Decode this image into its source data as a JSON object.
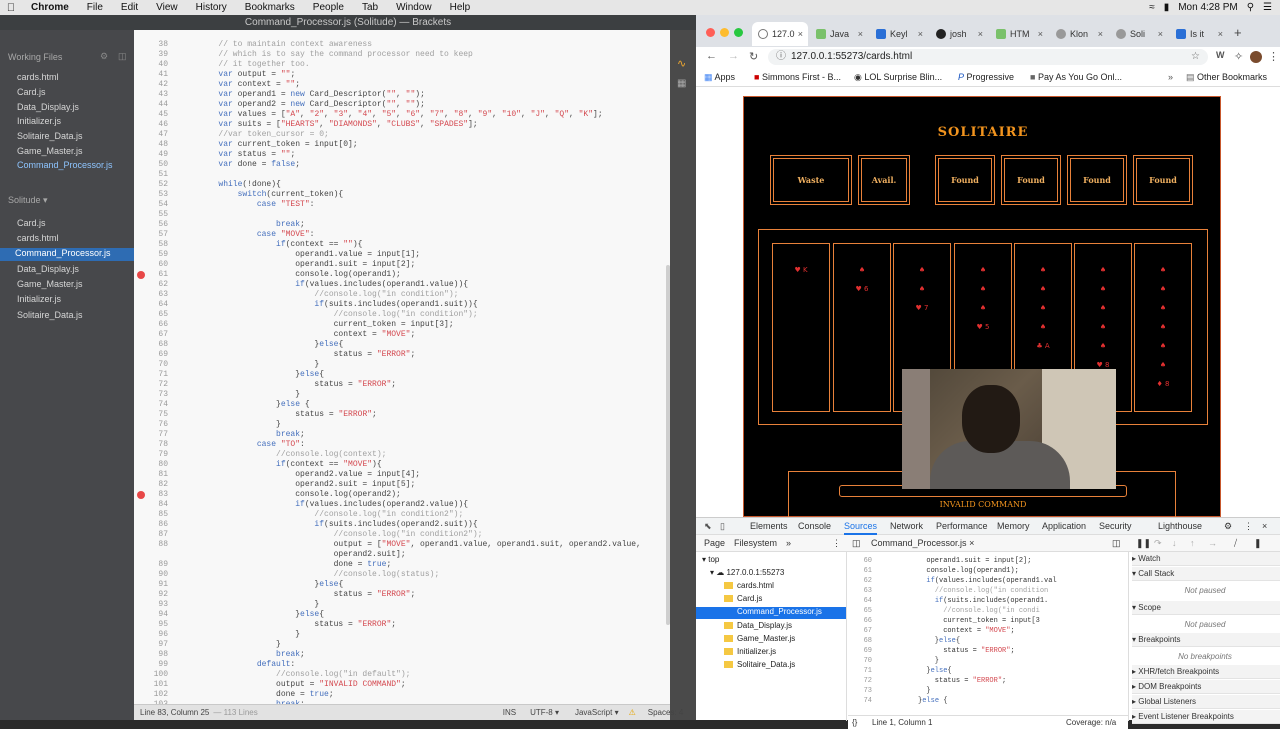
{
  "menubar": {
    "app": "Chrome",
    "items": [
      "File",
      "Edit",
      "View",
      "History",
      "Bookmarks",
      "People",
      "Tab",
      "Window",
      "Help"
    ],
    "clock": "Mon 4:28 PM"
  },
  "brackets": {
    "title": "Command_Processor.js (Solitude) — Brackets",
    "working_files_label": "Working Files",
    "working_files": [
      "cards.html",
      "Card.js",
      "Data_Display.js",
      "Initializer.js",
      "Solitaire_Data.js",
      "Game_Master.js",
      "Command_Processor.js"
    ],
    "project_label": "Solitude",
    "project_files": [
      "Card.js",
      "cards.html",
      "Command_Processor.js",
      "Data_Display.js",
      "Game_Master.js",
      "Initializer.js",
      "Solitaire_Data.js"
    ],
    "code_lines": [
      {
        "n": "38",
        "t": "        // to maintain context awareness"
      },
      {
        "n": "39",
        "t": "        // which is to say the command processor need to keep"
      },
      {
        "n": "40",
        "t": "        // it together too."
      },
      {
        "n": "41",
        "t": "        var output = \"\";"
      },
      {
        "n": "42",
        "t": "        var context = \"\";"
      },
      {
        "n": "43",
        "t": "        var operand1 = new Card_Descriptor(\"\", \"\");"
      },
      {
        "n": "44",
        "t": "        var operand2 = new Card_Descriptor(\"\", \"\");"
      },
      {
        "n": "45",
        "t": "        var values = [\"A\", \"2\", \"3\", \"4\", \"5\", \"6\", \"7\", \"8\", \"9\", \"10\", \"J\", \"Q\", \"K\"];"
      },
      {
        "n": "46",
        "t": "        var suits = [\"HEARTS\", \"DIAMONDS\", \"CLUBS\", \"SPADES\"];"
      },
      {
        "n": "47",
        "t": "        //var token_cursor = 0;"
      },
      {
        "n": "48",
        "t": "        var current_token = input[0];"
      },
      {
        "n": "49",
        "t": "        var status = \"\";"
      },
      {
        "n": "50",
        "t": "        var done = false;"
      },
      {
        "n": "51",
        "t": ""
      },
      {
        "n": "52",
        "t": "        while(!done){"
      },
      {
        "n": "53",
        "t": "            switch(current_token){"
      },
      {
        "n": "54",
        "t": "                case \"TEST\":"
      },
      {
        "n": "55",
        "t": ""
      },
      {
        "n": "56",
        "t": "                    break;"
      },
      {
        "n": "57",
        "t": "                case \"MOVE\":"
      },
      {
        "n": "58",
        "t": "                    if(context == \"\"){"
      },
      {
        "n": "59",
        "t": "                        operand1.value = input[1];"
      },
      {
        "n": "60",
        "t": "                        operand1.suit = input[2];"
      },
      {
        "n": "61",
        "t": "                        console.log(operand1);"
      },
      {
        "n": "62",
        "t": "                        if(values.includes(operand1.value)){"
      },
      {
        "n": "63",
        "t": "                            //console.log(\"in condition\");"
      },
      {
        "n": "64",
        "t": "                            if(suits.includes(operand1.suit)){"
      },
      {
        "n": "65",
        "t": "                                //console.log(\"in condition\");"
      },
      {
        "n": "66",
        "t": "                                current_token = input[3];"
      },
      {
        "n": "67",
        "t": "                                context = \"MOVE\";"
      },
      {
        "n": "68",
        "t": "                            }else{"
      },
      {
        "n": "69",
        "t": "                                status = \"ERROR\";"
      },
      {
        "n": "70",
        "t": "                            }"
      },
      {
        "n": "71",
        "t": "                        }else{"
      },
      {
        "n": "72",
        "t": "                            status = \"ERROR\";"
      },
      {
        "n": "73",
        "t": "                        }"
      },
      {
        "n": "74",
        "t": "                    }else {"
      },
      {
        "n": "75",
        "t": "                        status = \"ERROR\";"
      },
      {
        "n": "76",
        "t": "                    }"
      },
      {
        "n": "77",
        "t": "                    break;"
      },
      {
        "n": "78",
        "t": "                case \"TO\":"
      },
      {
        "n": "79",
        "t": "                    //console.log(context);"
      },
      {
        "n": "80",
        "t": "                    if(context == \"MOVE\"){"
      },
      {
        "n": "81",
        "t": "                        operand2.value = input[4];"
      },
      {
        "n": "82",
        "t": "                        operand2.suit = input[5];"
      },
      {
        "n": "83",
        "t": "                        console.log(operand2);"
      },
      {
        "n": "84",
        "t": "                        if(values.includes(operand2.value)){"
      },
      {
        "n": "85",
        "t": "                            //console.log(\"in condition2\");"
      },
      {
        "n": "86",
        "t": "                            if(suits.includes(operand2.suit)){"
      },
      {
        "n": "87",
        "t": "                                //console.log(\"in condition2\");"
      },
      {
        "n": "88",
        "t": "                                output = [\"MOVE\", operand1.value, operand1.suit, operand2.value,"
      },
      {
        "n": "",
        "t": "                                operand2.suit];"
      },
      {
        "n": "89",
        "t": "                                done = true;"
      },
      {
        "n": "90",
        "t": "                                //console.log(status);"
      },
      {
        "n": "91",
        "t": "                            }else{"
      },
      {
        "n": "92",
        "t": "                                status = \"ERROR\";"
      },
      {
        "n": "93",
        "t": "                            }"
      },
      {
        "n": "94",
        "t": "                        }else{"
      },
      {
        "n": "95",
        "t": "                            status = \"ERROR\";"
      },
      {
        "n": "96",
        "t": "                        }"
      },
      {
        "n": "97",
        "t": "                    }"
      },
      {
        "n": "98",
        "t": "                    break;"
      },
      {
        "n": "99",
        "t": "                default:"
      },
      {
        "n": "100",
        "t": "                    //console.log(\"in default\");"
      },
      {
        "n": "101",
        "t": "                    output = \"INVALID COMMAND\";"
      },
      {
        "n": "102",
        "t": "                    done = true;"
      },
      {
        "n": "103",
        "t": "                    break;"
      }
    ],
    "breakpoints": [
      "61",
      "83"
    ],
    "status": {
      "position": "Line 83, Column 25",
      "lines": "— 113 Lines",
      "ins": "INS",
      "encoding": "UTF-8",
      "language": "JavaScript",
      "spaces": "Spaces: 4"
    }
  },
  "chrome": {
    "tabs": [
      "127.0",
      "Java",
      "Keyl",
      "josh",
      "HTM",
      "Klon",
      "Soli",
      "Is it"
    ],
    "url": "127.0.0.1:55273/cards.html",
    "bookmarks": [
      "Apps",
      "Simmons First - B...",
      "LOL Surprise Blin...",
      "Progressive",
      "Pay As You Go Onl...",
      "Other Bookmarks"
    ],
    "more_bookmarks": "»"
  },
  "game": {
    "title": "SOLITAIRE",
    "slots": [
      "Waste",
      "Avail.",
      "Found",
      "Found",
      "Found",
      "Found"
    ],
    "piles": [
      [
        "♥ K"
      ],
      [
        "♠",
        "♥ 6"
      ],
      [
        "♠",
        "♠",
        "♥ 7"
      ],
      [
        "♠",
        "♠",
        "♠",
        "♥ 5"
      ],
      [
        "♠",
        "♠",
        "♠",
        "♠",
        "♣ A"
      ],
      [
        "♠",
        "♠",
        "♠",
        "♠",
        "♠",
        "♥ 8"
      ],
      [
        "♠",
        "♠",
        "♠",
        "♠",
        "♠",
        "♠",
        "♦ 8"
      ]
    ],
    "message": "INVALID COMMAND"
  },
  "devtools": {
    "tabs": [
      "Elements",
      "Console",
      "Sources",
      "Network",
      "Performance",
      "Memory",
      "Application",
      "Security",
      "Lighthouse"
    ],
    "active_tab": "Sources",
    "nav_tabs": [
      "Page",
      "Filesystem"
    ],
    "open_file": "Command_Processor.js",
    "tree": [
      "top",
      "127.0.0.1:55273",
      "cards.html",
      "Card.js",
      "Command_Processor.js",
      "Data_Display.js",
      "Game_Master.js",
      "Initializer.js",
      "Solitaire_Data.js"
    ],
    "source_lines": [
      {
        "n": "60",
        "t": "            operand1.suit = input[2];"
      },
      {
        "n": "61",
        "t": "            console.log(operand1);"
      },
      {
        "n": "62",
        "t": "            if(values.includes(operand1.val"
      },
      {
        "n": "63",
        "t": "              //console.log(\"in condition"
      },
      {
        "n": "64",
        "t": "              if(suits.includes(operand1."
      },
      {
        "n": "65",
        "t": "                //console.log(\"in condi"
      },
      {
        "n": "66",
        "t": "                current_token = input[3"
      },
      {
        "n": "67",
        "t": "                context = \"MOVE\";"
      },
      {
        "n": "68",
        "t": "              }else{"
      },
      {
        "n": "69",
        "t": "                status = \"ERROR\";"
      },
      {
        "n": "70",
        "t": "              }"
      },
      {
        "n": "71",
        "t": "            }else{"
      },
      {
        "n": "72",
        "t": "              status = \"ERROR\";"
      },
      {
        "n": "73",
        "t": "            }"
      },
      {
        "n": "74",
        "t": "          }else {"
      }
    ],
    "cursor": "Line 1, Column 1",
    "coverage": "Coverage: n/a",
    "panels": [
      "Watch",
      "Call Stack",
      "Scope",
      "Breakpoints",
      "XHR/fetch Breakpoints",
      "DOM Breakpoints",
      "Global Listeners",
      "Event Listener Breakpoints"
    ],
    "not_paused": "Not paused",
    "no_breakpoints": "No breakpoints"
  }
}
